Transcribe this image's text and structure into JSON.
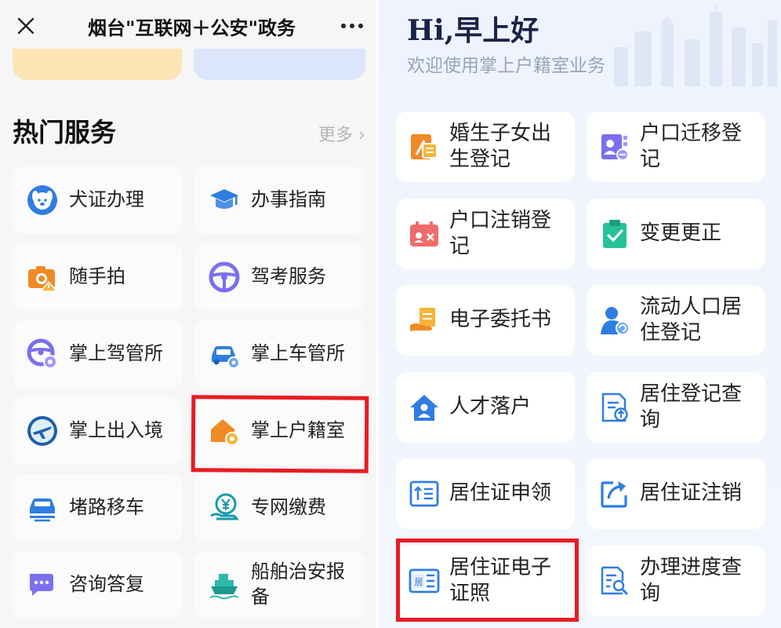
{
  "left_panel": {
    "title": "烟台\"互联网＋公安\"政务",
    "section_title": "热门服务",
    "more_label": "更多 ›",
    "services": [
      {
        "label": "犬证办理",
        "icon": "dog-icon"
      },
      {
        "label": "办事指南",
        "icon": "graduation-cap-icon"
      },
      {
        "label": "随手拍",
        "icon": "camera-icon"
      },
      {
        "label": "驾考服务",
        "icon": "steering-wheel-icon"
      },
      {
        "label": "掌上驾管所",
        "icon": "steering-wheel-gear-icon"
      },
      {
        "label": "掌上车管所",
        "icon": "car-gear-icon"
      },
      {
        "label": "掌上出入境",
        "icon": "airplane-globe-icon"
      },
      {
        "label": "掌上户籍室",
        "icon": "house-gear-icon"
      },
      {
        "label": "堵路移车",
        "icon": "car-move-icon"
      },
      {
        "label": "专网缴费",
        "icon": "yen-hand-icon"
      },
      {
        "label": "咨询答复",
        "icon": "chat-bubbles-icon"
      },
      {
        "label": "船舶治安报备",
        "icon": "ship-icon"
      }
    ]
  },
  "right_panel": {
    "greeting": "Hi,早上好",
    "welcome": "欢迎使用掌上户籍室业务",
    "services": [
      {
        "label": "婚生子女出生登记",
        "icon": "birth-register-icon"
      },
      {
        "label": "户口迁移登记",
        "icon": "household-transfer-icon"
      },
      {
        "label": "户口注销登记",
        "icon": "household-cancel-icon"
      },
      {
        "label": "变更更正",
        "icon": "clipboard-check-icon"
      },
      {
        "label": "电子委托书",
        "icon": "hand-document-icon"
      },
      {
        "label": "流动人口居住登记",
        "icon": "person-refresh-icon"
      },
      {
        "label": "人才落户",
        "icon": "house-person-icon"
      },
      {
        "label": "居住登记查询",
        "icon": "document-upload-icon"
      },
      {
        "label": "居住证申领",
        "icon": "id-card-apply-icon"
      },
      {
        "label": "居住证注销",
        "icon": "share-arrow-icon"
      },
      {
        "label": "居住证电子证照",
        "icon": "residence-card-icon"
      },
      {
        "label": "办理进度查询",
        "icon": "document-search-icon"
      }
    ]
  },
  "colors": {
    "highlight": "#e81c24",
    "brand_blue": "#2f7de1",
    "orange": "#f08a24",
    "purple": "#7b6ff0"
  }
}
